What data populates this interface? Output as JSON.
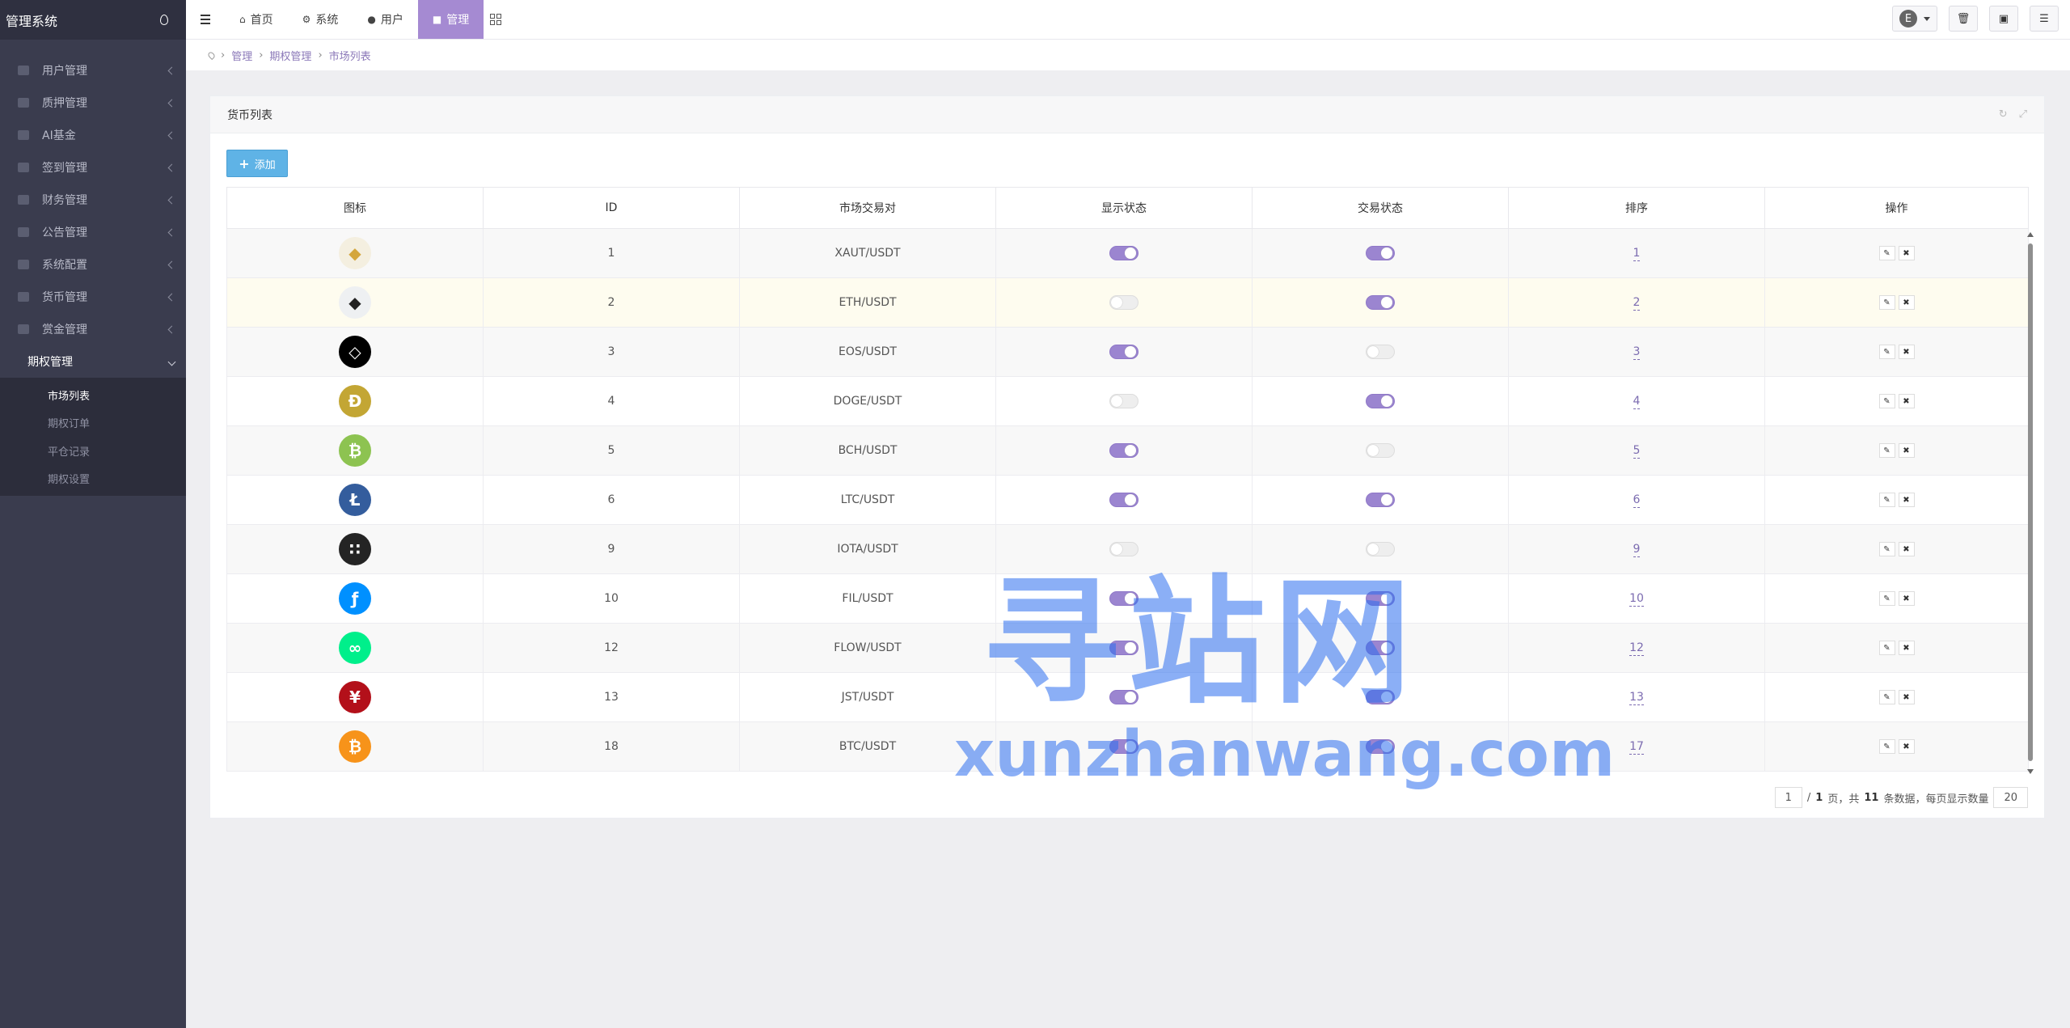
{
  "sidebar": {
    "brand": "管理系统",
    "menu": [
      {
        "label": "用户管理"
      },
      {
        "label": "质押管理"
      },
      {
        "label": "AI基金"
      },
      {
        "label": "签到管理"
      },
      {
        "label": "财务管理"
      },
      {
        "label": "公告管理"
      },
      {
        "label": "系统配置"
      },
      {
        "label": "货币管理"
      },
      {
        "label": "赏金管理"
      }
    ],
    "open_menu": "期权管理",
    "submenu": [
      {
        "label": "市场列表",
        "active": true
      },
      {
        "label": "期权订单",
        "active": false
      },
      {
        "label": "平仓记录",
        "active": false
      },
      {
        "label": "期权设置",
        "active": false
      }
    ]
  },
  "topbar": {
    "tabs": [
      {
        "label": "首页",
        "icon": "home-icon"
      },
      {
        "label": "系统",
        "icon": "gear-icon"
      },
      {
        "label": "用户",
        "icon": "user-icon"
      },
      {
        "label": "管理",
        "icon": "bag-icon",
        "active": true
      }
    ],
    "avatar_letter": "E"
  },
  "breadcrumb": [
    "管理",
    "期权管理",
    "市场列表"
  ],
  "panel": {
    "title": "货币列表",
    "add_label": "添加"
  },
  "table": {
    "headers": [
      "图标",
      "ID",
      "市场交易对",
      "显示状态",
      "交易状态",
      "排序",
      "操作"
    ],
    "rows": [
      {
        "coin": "xaut",
        "id": "1",
        "pair": "XAUT/USDT",
        "display": true,
        "trade": true,
        "sort": "1"
      },
      {
        "coin": "eth",
        "id": "2",
        "pair": "ETH/USDT",
        "display": false,
        "trade": true,
        "sort": "2"
      },
      {
        "coin": "eos",
        "id": "3",
        "pair": "EOS/USDT",
        "display": true,
        "trade": false,
        "sort": "3"
      },
      {
        "coin": "doge",
        "id": "4",
        "pair": "DOGE/USDT",
        "display": false,
        "trade": true,
        "sort": "4"
      },
      {
        "coin": "bch",
        "id": "5",
        "pair": "BCH/USDT",
        "display": true,
        "trade": false,
        "sort": "5"
      },
      {
        "coin": "ltc",
        "id": "6",
        "pair": "LTC/USDT",
        "display": true,
        "trade": true,
        "sort": "6"
      },
      {
        "coin": "iota",
        "id": "9",
        "pair": "IOTA/USDT",
        "display": false,
        "trade": false,
        "sort": "9"
      },
      {
        "coin": "fil",
        "id": "10",
        "pair": "FIL/USDT",
        "display": true,
        "trade": true,
        "sort": "10"
      },
      {
        "coin": "flow",
        "id": "12",
        "pair": "FLOW/USDT",
        "display": true,
        "trade": true,
        "sort": "12"
      },
      {
        "coin": "jst",
        "id": "13",
        "pair": "JST/USDT",
        "display": true,
        "trade": true,
        "sort": "13"
      },
      {
        "coin": "btc",
        "id": "18",
        "pair": "BTC/USDT",
        "display": true,
        "trade": true,
        "sort": "17"
      }
    ]
  },
  "pager": {
    "page": "1",
    "text_pre": "/",
    "total_pages": "1",
    "text_mid": "页，共",
    "total": "11",
    "text_post": "条数据，每页显示数量",
    "per_page": "20"
  },
  "watermark": {
    "cn": "寻站网",
    "en": "xunzhanwang.com"
  },
  "colors": {
    "sidebar_bg": "#3a3c4e",
    "accent": "#a58ad2",
    "toggle_on": "#9b85d0",
    "add_button": "#5fb3e6"
  }
}
